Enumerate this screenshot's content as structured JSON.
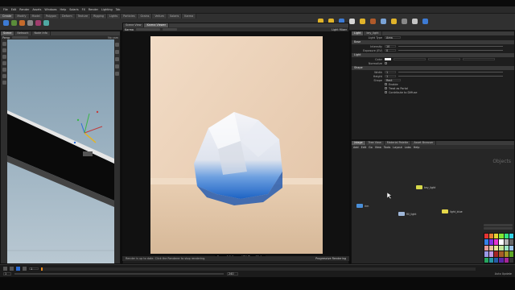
{
  "menubar": {
    "items": [
      "File",
      "Edit",
      "Render",
      "Assets",
      "Windows",
      "Help",
      "Solaris",
      "FX",
      "Render",
      "Lighting",
      "Tab"
    ]
  },
  "shelf": {
    "tabs": [
      "Create",
      "Modify",
      "Model",
      "Polygon",
      "Deform",
      "Texture",
      "Rigging",
      "Lights",
      "Particles",
      "Grains",
      "Vellum",
      "Solaris",
      "Karma"
    ]
  },
  "left_pane": {
    "tabs": [
      "Scene",
      "Network",
      "Node Info"
    ],
    "view_label": "Persp",
    "cam_label": "No cam"
  },
  "render_pane": {
    "tabs": [
      "Scene View",
      "Karma Viewer"
    ],
    "toolbar_left": "Karma",
    "toolbar_right": "Light Mixer",
    "caption": "Frame 1/1  Karma XPU  Time 12.4s",
    "status_left": "Render is up to date. Click the Renderer to stop rendering.",
    "status_right": "Progressive Rendering"
  },
  "params": {
    "node_type": "Light",
    "node_name": "key_light",
    "light_type_label": "Light Type",
    "light_type_value": "Area",
    "sections": [
      "Base",
      "Light",
      "Shape"
    ],
    "rows": [
      {
        "label": "Intensity",
        "value": "10"
      },
      {
        "label": "Exposure (EV)",
        "value": "0"
      },
      {
        "label": "Color",
        "value": ""
      },
      {
        "label": "Normalize",
        "value": ""
      },
      {
        "label": "Width",
        "value": "1"
      },
      {
        "label": "Height",
        "value": "1"
      },
      {
        "label": "Shape",
        "value": "Rect"
      }
    ],
    "checks": [
      "Enable",
      "Treat as Portal",
      "Contribute to Diffuse"
    ]
  },
  "network": {
    "tabs": [
      "/stage",
      "Tree View",
      "Material Palette",
      "Asset Browser"
    ],
    "menu": [
      "Add",
      "Edit",
      "Go",
      "View",
      "Tools",
      "Layout",
      "Labs",
      "Help"
    ],
    "path_label": "Objects",
    "nodes": [
      {
        "label": "key_light",
        "color": "#d7d94a"
      },
      {
        "label": "rim",
        "color": "#4a8fd9"
      },
      {
        "label": "fill_light",
        "color": "#9fb7d9"
      },
      {
        "label": "light_blue",
        "color": "#e6d84a"
      }
    ]
  },
  "timeline": {
    "frame": "1",
    "start": "1",
    "end": "240",
    "status": "Auto Update"
  },
  "palette_colors": [
    "#e63333",
    "#e68033",
    "#e6d233",
    "#80e633",
    "#33e680",
    "#33d2e6",
    "#3380e6",
    "#8033e6",
    "#e633d2",
    "#ffffff",
    "#b3b3b3",
    "#666666",
    "#e69999",
    "#e6c299",
    "#e6e699",
    "#c2e699",
    "#99e6c2",
    "#99c2e6",
    "#9999e6",
    "#c299e6",
    "#a62626",
    "#a65d26",
    "#a69626",
    "#5da626",
    "#26a65d",
    "#2696a6",
    "#265da6",
    "#5d26a6",
    "#a62696",
    "#333333"
  ],
  "colors": {
    "accent_orange": "#e68a1f",
    "accent_blue": "#2a6dd6",
    "menu_bg": "#2a2a2a"
  }
}
